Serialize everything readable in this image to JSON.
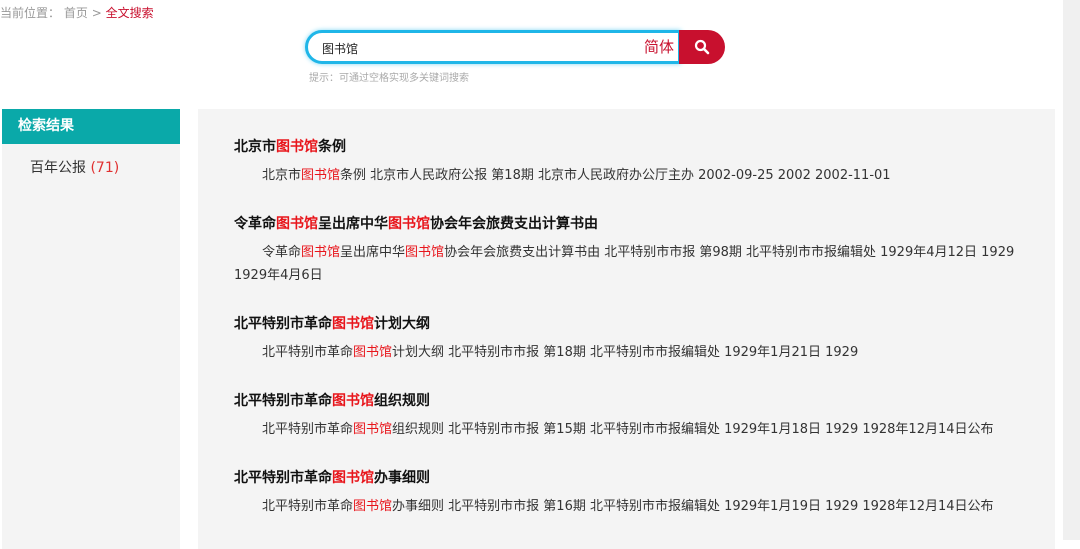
{
  "breadcrumb": {
    "label": "当前位置：",
    "home": "首页",
    "sep": ">",
    "current": "全文搜索"
  },
  "search": {
    "value": "图书馆",
    "lang": "简体",
    "hint": "提示：可通过空格实现多关键词搜索"
  },
  "sidebar": {
    "title": "检索结果",
    "items": [
      {
        "label": "百年公报",
        "count": "(71)"
      }
    ]
  },
  "results": [
    {
      "title": [
        [
          "北京市",
          0
        ],
        [
          "图书馆",
          1
        ],
        [
          "条例",
          0
        ]
      ],
      "desc": [
        [
          "北京市",
          0
        ],
        [
          "图书馆",
          1
        ],
        [
          "条例 北京市人民政府公报 第18期 北京市人民政府办公厅主办 2002-09-25 2002 2002-11-01",
          0
        ]
      ]
    },
    {
      "title": [
        [
          "令革命",
          0
        ],
        [
          "图书馆",
          1
        ],
        [
          "呈出席中华",
          0
        ],
        [
          "图书馆",
          1
        ],
        [
          "协会年会旅费支出计算书由",
          0
        ]
      ],
      "desc": [
        [
          "令革命",
          0
        ],
        [
          "图书馆",
          1
        ],
        [
          "呈出席中华",
          0
        ],
        [
          "图书馆",
          1
        ],
        [
          "协会年会旅费支出计算书由 北平特别市市报 第98期 北平特别市市报编辑处 1929年4月12日 1929 1929年4月6日",
          0
        ]
      ]
    },
    {
      "title": [
        [
          "北平特别市革命",
          0
        ],
        [
          "图书馆",
          1
        ],
        [
          "计划大纲",
          0
        ]
      ],
      "desc": [
        [
          "北平特别市革命",
          0
        ],
        [
          "图书馆",
          1
        ],
        [
          "计划大纲 北平特别市市报 第18期 北平特别市市报编辑处 1929年1月21日 1929",
          0
        ]
      ]
    },
    {
      "title": [
        [
          "北平特别市革命",
          0
        ],
        [
          "图书馆",
          1
        ],
        [
          "组织规则",
          0
        ]
      ],
      "desc": [
        [
          "北平特别市革命",
          0
        ],
        [
          "图书馆",
          1
        ],
        [
          "组织规则 北平特别市市报 第15期 北平特别市市报编辑处 1929年1月18日 1929 1928年12月14日公布",
          0
        ]
      ]
    },
    {
      "title": [
        [
          "北平特别市革命",
          0
        ],
        [
          "图书馆",
          1
        ],
        [
          "办事细则",
          0
        ]
      ],
      "desc": [
        [
          "北平特别市革命",
          0
        ],
        [
          "图书馆",
          1
        ],
        [
          "办事细则 北平特别市市报 第16期 北平特别市市报编辑处 1929年1月19日 1929 1928年12月14日公布",
          0
        ]
      ]
    }
  ],
  "colors": {
    "accent": "#c8102e",
    "teal": "#0aa9a9",
    "highlight": "#e8151b",
    "search_border": "#1fb6e8"
  }
}
